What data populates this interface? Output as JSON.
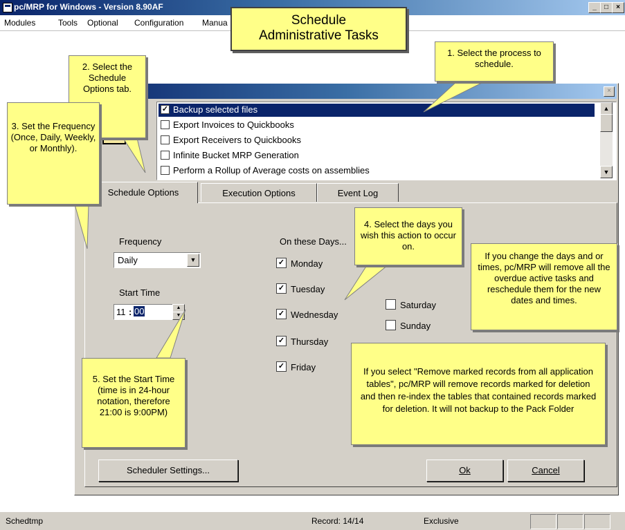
{
  "app": {
    "title": "pc/MRP for Windows - Version 8.90AF",
    "window_buttons": [
      "_",
      "□",
      "×"
    ]
  },
  "menu": [
    "Modules",
    "Tools",
    "Optional",
    "Configuration",
    "Manua"
  ],
  "banner": {
    "line1": "Schedule",
    "line2": "Administrative Tasks"
  },
  "dialog": {
    "close_glyph": "×",
    "processes": [
      {
        "label": "Backup selected files",
        "checked": true,
        "selected": true
      },
      {
        "label": "Export Invoices to Quickbooks",
        "checked": false,
        "selected": false
      },
      {
        "label": "Export Receivers to Quickbooks",
        "checked": false,
        "selected": false
      },
      {
        "label": "Infinite Bucket MRP Generation",
        "checked": false,
        "selected": false
      },
      {
        "label": "Perform a Rollup of Average costs on assemblies",
        "checked": false,
        "selected": false
      }
    ],
    "tabs": [
      "Schedule Options",
      "Execution Options",
      "Event Log"
    ],
    "frequency_label": "Frequency",
    "frequency_value": "Daily",
    "start_time_label": "Start Time",
    "start_hour": "11",
    "start_sep": ":",
    "start_minute": "00",
    "days_label": "On these Days...",
    "days": [
      {
        "name": "Monday",
        "checked": true
      },
      {
        "name": "Tuesday",
        "checked": true
      },
      {
        "name": "Wednesday",
        "checked": true
      },
      {
        "name": "Thursday",
        "checked": true
      },
      {
        "name": "Friday",
        "checked": true
      },
      {
        "name": "Saturday",
        "checked": false
      },
      {
        "name": "Sunday",
        "checked": false
      }
    ],
    "scheduler_settings_label": "Scheduler Settings...",
    "ok_label": "Ok",
    "cancel_label": "Cancel"
  },
  "callouts": {
    "c1": "1. Select the process to schedule.",
    "c2": "2. Select the Schedule Options tab.",
    "c3": "3. Set the Frequency (Once, Daily, Weekly, or Monthly).",
    "c4": "4.  Select the days you wish this action to occur on.",
    "c5": "5. Set the Start Time (time is in 24-hour notation, therefore 21:00 is 9:00PM)",
    "c6": "If you change the days and or times, pc/MRP will remove all the overdue active tasks and reschedule them for the new dates and times.",
    "c7": "If you select \"Remove marked records from all application tables\", pc/MRP will remove records marked for deletion and then re-index the tables that contained records marked for deletion.  It will not backup to the Pack Folder"
  },
  "status": {
    "left": "Schedtmp",
    "record": "Record: 14/14",
    "mode": "Exclusive"
  },
  "colors": {
    "callout": "#ffff88",
    "titlebar": "#0a246a",
    "dialog_face": "#d4d0c8"
  }
}
